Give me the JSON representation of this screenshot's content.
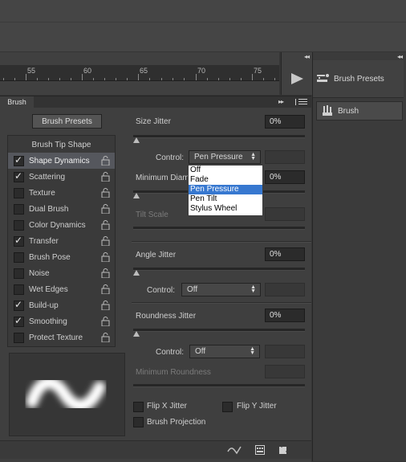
{
  "ruler": {
    "ticks": [
      "55",
      "60",
      "65",
      "70",
      "75"
    ]
  },
  "right_panel": {
    "collapse": "◂◂",
    "items": [
      {
        "label": "Brush Presets",
        "icon": "brush-presets-icon"
      },
      {
        "label": "Brush",
        "icon": "brush-icon"
      }
    ]
  },
  "panel": {
    "tab": "Brush",
    "collapse": "▸▸",
    "presets_button": "Brush Presets",
    "list_header": "Brush Tip Shape",
    "items": [
      {
        "label": "Shape Dynamics",
        "checked": true,
        "selected": true
      },
      {
        "label": "Scattering",
        "checked": true
      },
      {
        "label": "Texture",
        "checked": false
      },
      {
        "label": "Dual Brush",
        "checked": false
      },
      {
        "label": "Color Dynamics",
        "checked": false
      },
      {
        "label": "Transfer",
        "checked": true
      },
      {
        "label": "Brush Pose",
        "checked": false
      },
      {
        "label": "Noise",
        "checked": false
      },
      {
        "label": "Wet Edges",
        "checked": false
      },
      {
        "label": "Build-up",
        "checked": true
      },
      {
        "label": "Smoothing",
        "checked": true
      },
      {
        "label": "Protect Texture",
        "checked": false
      }
    ]
  },
  "settings": {
    "size_jitter": {
      "label": "Size Jitter",
      "value": "0%"
    },
    "control_label": "Control:",
    "size_control": "Pen Pressure",
    "min_diameter": {
      "label": "Minimum Diameter",
      "value": "0%"
    },
    "tilt_scale": "Tilt Scale",
    "angle_jitter": {
      "label": "Angle Jitter",
      "value": "0%"
    },
    "angle_control": "Off",
    "roundness_jitter": {
      "label": "Roundness Jitter",
      "value": "0%"
    },
    "roundness_control": "Off",
    "min_roundness": "Minimum Roundness",
    "flip_x": "Flip X Jitter",
    "flip_y": "Flip Y Jitter",
    "brush_projection": "Brush Projection"
  },
  "dropdown": {
    "options": [
      "Off",
      "Fade",
      "Pen Pressure",
      "Pen Tilt",
      "Stylus Wheel"
    ],
    "highlighted": "Pen Pressure"
  }
}
